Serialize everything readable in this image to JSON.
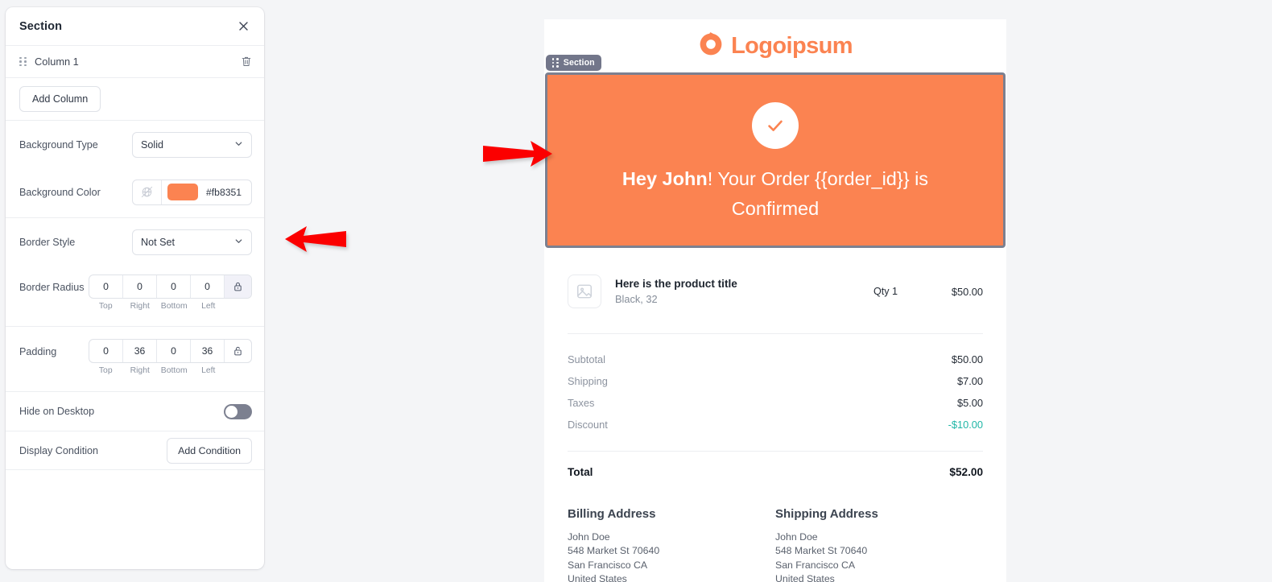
{
  "panel": {
    "title": "Section",
    "close_icon": "close-icon",
    "column": {
      "label": "Column 1",
      "drag_icon": "drag-handle-icon",
      "delete_icon": "trash-icon"
    },
    "add_column_label": "Add Column",
    "background_type": {
      "label": "Background Type",
      "value": "Solid"
    },
    "background_color": {
      "label": "Background Color",
      "hex": "#fb8351",
      "swatch": "#fb8351",
      "no_color_icon": "no-color-icon"
    },
    "border_style": {
      "label": "Border Style",
      "value": "Not Set"
    },
    "border_radius": {
      "label": "Border Radius",
      "values": [
        "0",
        "0",
        "0",
        "0"
      ],
      "captions": [
        "Top",
        "Right",
        "Bottom",
        "Left"
      ],
      "lock_icon": "lock-closed-icon",
      "locked": true
    },
    "padding": {
      "label": "Padding",
      "values": [
        "0",
        "36",
        "0",
        "36"
      ],
      "captions": [
        "Top",
        "Right",
        "Bottom",
        "Left"
      ],
      "lock_icon": "lock-open-icon",
      "locked": false
    },
    "hide_on_desktop": {
      "label": "Hide on Desktop",
      "enabled": false
    },
    "display_condition": {
      "label": "Display Condition",
      "button": "Add Condition"
    }
  },
  "email": {
    "logo": {
      "text": "Logoipsum",
      "mark": "logoipsum-mark-icon",
      "color": "#fb8351"
    },
    "section_badge": {
      "label": "Section",
      "drag_icon": "drag-handle-icon"
    },
    "hero": {
      "background": "#fb8351",
      "check_icon": "check-icon",
      "greeting_bold": "Hey John",
      "headline_rest": "! Your Order {{order_id}} is Confirmed"
    },
    "product": {
      "thumb_icon": "image-placeholder-icon",
      "title": "Here is the product title",
      "variant": "Black, 32",
      "qty": "Qty 1",
      "price": "$50.00"
    },
    "totals": [
      {
        "label": "Subtotal",
        "value": "$50.00",
        "accent": false
      },
      {
        "label": "Shipping",
        "value": "$7.00",
        "accent": false
      },
      {
        "label": "Taxes",
        "value": "$5.00",
        "accent": false
      },
      {
        "label": "Discount",
        "value": "-$10.00",
        "accent": true
      }
    ],
    "total": {
      "label": "Total",
      "value": "$52.00"
    },
    "billing": {
      "heading": "Billing Address",
      "lines": [
        "John Doe",
        "548 Market St 70640",
        "San Francisco CA",
        "United States"
      ]
    },
    "shipping": {
      "heading": "Shipping Address",
      "lines": [
        "John Doe",
        "548 Market St 70640",
        "San Francisco CA",
        "United States"
      ]
    }
  },
  "annotations": {
    "arrow_color": "#fb0000",
    "arrow_left": "arrow-pointing-left",
    "arrow_right": "arrow-pointing-right"
  }
}
